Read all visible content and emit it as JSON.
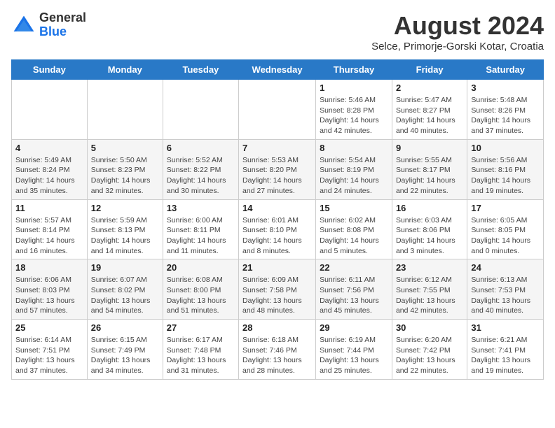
{
  "header": {
    "logo_line1": "General",
    "logo_line2": "Blue",
    "month_title": "August 2024",
    "location": "Selce, Primorje-Gorski Kotar, Croatia"
  },
  "days_of_week": [
    "Sunday",
    "Monday",
    "Tuesday",
    "Wednesday",
    "Thursday",
    "Friday",
    "Saturday"
  ],
  "weeks": [
    [
      {
        "day": "",
        "info": ""
      },
      {
        "day": "",
        "info": ""
      },
      {
        "day": "",
        "info": ""
      },
      {
        "day": "",
        "info": ""
      },
      {
        "day": "1",
        "info": "Sunrise: 5:46 AM\nSunset: 8:28 PM\nDaylight: 14 hours and 42 minutes."
      },
      {
        "day": "2",
        "info": "Sunrise: 5:47 AM\nSunset: 8:27 PM\nDaylight: 14 hours and 40 minutes."
      },
      {
        "day": "3",
        "info": "Sunrise: 5:48 AM\nSunset: 8:26 PM\nDaylight: 14 hours and 37 minutes."
      }
    ],
    [
      {
        "day": "4",
        "info": "Sunrise: 5:49 AM\nSunset: 8:24 PM\nDaylight: 14 hours and 35 minutes."
      },
      {
        "day": "5",
        "info": "Sunrise: 5:50 AM\nSunset: 8:23 PM\nDaylight: 14 hours and 32 minutes."
      },
      {
        "day": "6",
        "info": "Sunrise: 5:52 AM\nSunset: 8:22 PM\nDaylight: 14 hours and 30 minutes."
      },
      {
        "day": "7",
        "info": "Sunrise: 5:53 AM\nSunset: 8:20 PM\nDaylight: 14 hours and 27 minutes."
      },
      {
        "day": "8",
        "info": "Sunrise: 5:54 AM\nSunset: 8:19 PM\nDaylight: 14 hours and 24 minutes."
      },
      {
        "day": "9",
        "info": "Sunrise: 5:55 AM\nSunset: 8:17 PM\nDaylight: 14 hours and 22 minutes."
      },
      {
        "day": "10",
        "info": "Sunrise: 5:56 AM\nSunset: 8:16 PM\nDaylight: 14 hours and 19 minutes."
      }
    ],
    [
      {
        "day": "11",
        "info": "Sunrise: 5:57 AM\nSunset: 8:14 PM\nDaylight: 14 hours and 16 minutes."
      },
      {
        "day": "12",
        "info": "Sunrise: 5:59 AM\nSunset: 8:13 PM\nDaylight: 14 hours and 14 minutes."
      },
      {
        "day": "13",
        "info": "Sunrise: 6:00 AM\nSunset: 8:11 PM\nDaylight: 14 hours and 11 minutes."
      },
      {
        "day": "14",
        "info": "Sunrise: 6:01 AM\nSunset: 8:10 PM\nDaylight: 14 hours and 8 minutes."
      },
      {
        "day": "15",
        "info": "Sunrise: 6:02 AM\nSunset: 8:08 PM\nDaylight: 14 hours and 5 minutes."
      },
      {
        "day": "16",
        "info": "Sunrise: 6:03 AM\nSunset: 8:06 PM\nDaylight: 14 hours and 3 minutes."
      },
      {
        "day": "17",
        "info": "Sunrise: 6:05 AM\nSunset: 8:05 PM\nDaylight: 14 hours and 0 minutes."
      }
    ],
    [
      {
        "day": "18",
        "info": "Sunrise: 6:06 AM\nSunset: 8:03 PM\nDaylight: 13 hours and 57 minutes."
      },
      {
        "day": "19",
        "info": "Sunrise: 6:07 AM\nSunset: 8:02 PM\nDaylight: 13 hours and 54 minutes."
      },
      {
        "day": "20",
        "info": "Sunrise: 6:08 AM\nSunset: 8:00 PM\nDaylight: 13 hours and 51 minutes."
      },
      {
        "day": "21",
        "info": "Sunrise: 6:09 AM\nSunset: 7:58 PM\nDaylight: 13 hours and 48 minutes."
      },
      {
        "day": "22",
        "info": "Sunrise: 6:11 AM\nSunset: 7:56 PM\nDaylight: 13 hours and 45 minutes."
      },
      {
        "day": "23",
        "info": "Sunrise: 6:12 AM\nSunset: 7:55 PM\nDaylight: 13 hours and 42 minutes."
      },
      {
        "day": "24",
        "info": "Sunrise: 6:13 AM\nSunset: 7:53 PM\nDaylight: 13 hours and 40 minutes."
      }
    ],
    [
      {
        "day": "25",
        "info": "Sunrise: 6:14 AM\nSunset: 7:51 PM\nDaylight: 13 hours and 37 minutes."
      },
      {
        "day": "26",
        "info": "Sunrise: 6:15 AM\nSunset: 7:49 PM\nDaylight: 13 hours and 34 minutes."
      },
      {
        "day": "27",
        "info": "Sunrise: 6:17 AM\nSunset: 7:48 PM\nDaylight: 13 hours and 31 minutes."
      },
      {
        "day": "28",
        "info": "Sunrise: 6:18 AM\nSunset: 7:46 PM\nDaylight: 13 hours and 28 minutes."
      },
      {
        "day": "29",
        "info": "Sunrise: 6:19 AM\nSunset: 7:44 PM\nDaylight: 13 hours and 25 minutes."
      },
      {
        "day": "30",
        "info": "Sunrise: 6:20 AM\nSunset: 7:42 PM\nDaylight: 13 hours and 22 minutes."
      },
      {
        "day": "31",
        "info": "Sunrise: 6:21 AM\nSunset: 7:41 PM\nDaylight: 13 hours and 19 minutes."
      }
    ]
  ]
}
